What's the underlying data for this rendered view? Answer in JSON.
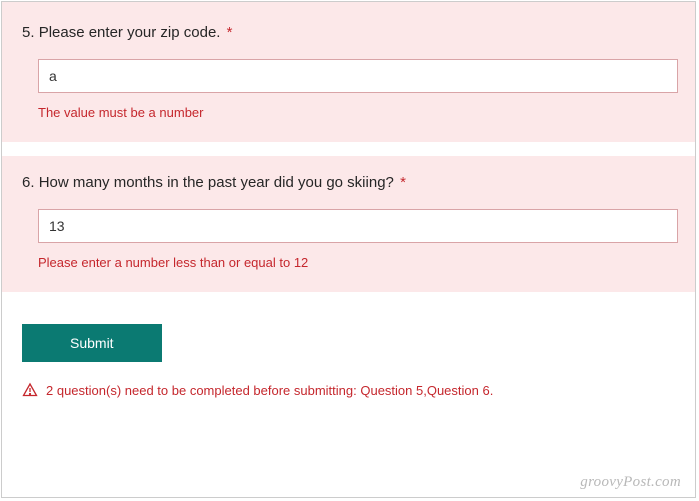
{
  "questions": [
    {
      "number": "5.",
      "text": "Please enter your zip code.",
      "required": "*",
      "value": "a",
      "error": "The value must be a number"
    },
    {
      "number": "6.",
      "text": "How many months in the past year did you go skiing?",
      "required": "*",
      "value": "13",
      "error": "Please enter a number less than or equal to 12"
    }
  ],
  "submit": {
    "label": "Submit"
  },
  "warning": {
    "text": "2 question(s) need to be completed before submitting: Question 5,Question 6."
  },
  "watermark": "groovyPost.com"
}
